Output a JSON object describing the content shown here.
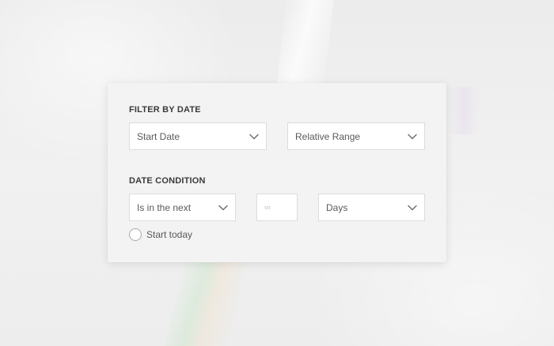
{
  "filter_by_date": {
    "title": "FILTER BY DATE",
    "date_field": {
      "value": "Start Date",
      "icon": "chevron-down-icon"
    },
    "range_type": {
      "value": "Relative Range",
      "icon": "chevron-down-icon"
    }
  },
  "date_condition": {
    "title": "DATE CONDITION",
    "operator": {
      "value": "Is in the next",
      "icon": "chevron-down-icon"
    },
    "amount": {
      "value": "",
      "placeholder": "∞"
    },
    "unit": {
      "value": "Days",
      "icon": "chevron-down-icon"
    },
    "start_today": {
      "label": "Start today",
      "checked": false
    }
  },
  "colors": {
    "panel_bg": "#f3f3f3",
    "field_bg": "#ffffff",
    "field_border": "#dcdcdc",
    "title_text": "#3a3a3a",
    "value_text": "#5a5a5a",
    "chevron": "#6a6a6a"
  }
}
